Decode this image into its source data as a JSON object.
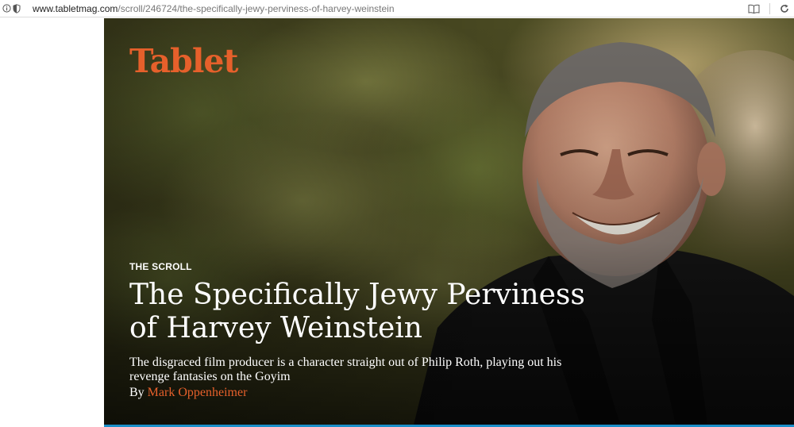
{
  "browser": {
    "url_host": "www.tabletmag.com",
    "url_path": "/scroll/246724/the-specifically-jewy-perviness-of-harvey-weinstein",
    "icons": [
      "info-icon",
      "shield-icon",
      "reader-view-icon",
      "reload-icon"
    ]
  },
  "hero": {
    "logo": "Tablet",
    "kicker": "THE SCROLL",
    "headline_line1": "The Specifically Jewy Perviness",
    "headline_line2": "of Harvey Weinstein",
    "dek_line1": "The disgraced film producer is a character straight out of Philip Roth, playing out his",
    "dek_line2": "revenge fantasies on the Goyim",
    "byline_prefix": "By",
    "author": "Mark Oppenheimer"
  },
  "colors": {
    "brand_orange": "#e6602b",
    "rule_blue": "#1a8fc9",
    "text_white": "#ffffff"
  }
}
